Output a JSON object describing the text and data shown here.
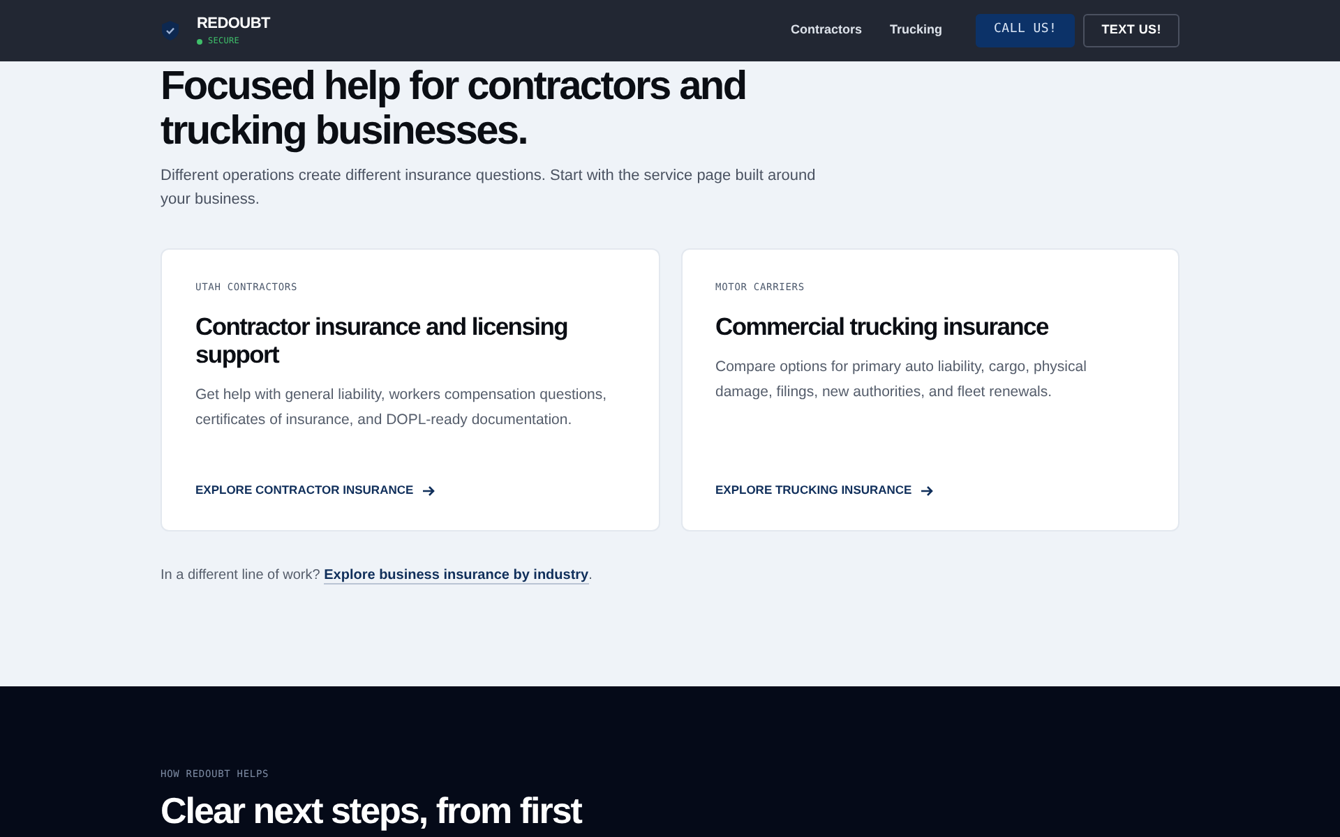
{
  "header": {
    "brand": "REDOUBT",
    "status": "SECURE",
    "nav": [
      "Contractors",
      "Trucking"
    ],
    "buttons": [
      {
        "label": "CALL US!",
        "kind": "primary"
      },
      {
        "label": "TEXT US!",
        "kind": "outline"
      }
    ]
  },
  "intro": {
    "title": "Focused help for contractors and trucking businesses.",
    "text": "Different operations create different insurance questions. Start with the service page built around your business."
  },
  "cards": [
    {
      "eyebrow": "UTAH CONTRACTORS",
      "title": "Contractor insurance and licensing support",
      "text": "Get help with general liability, workers compensation questions, certificates of insurance, and DOPL-ready documentation.",
      "link": "EXPLORE CONTRACTOR INSURANCE"
    },
    {
      "eyebrow": "MOTOR CARRIERS",
      "title": "Commercial trucking insurance",
      "text": "Compare options for primary auto liability, cargo, physical damage, filings, new authorities, and fleet renewals.",
      "link": "EXPLORE TRUCKING INSURANCE"
    }
  ],
  "more": {
    "text": "In a different line of work?",
    "link": "Explore business insurance by industry",
    "end": "."
  },
  "helps": {
    "eyebrow": "HOW REDOUBT HELPS",
    "title": "Clear next steps, from first"
  }
}
